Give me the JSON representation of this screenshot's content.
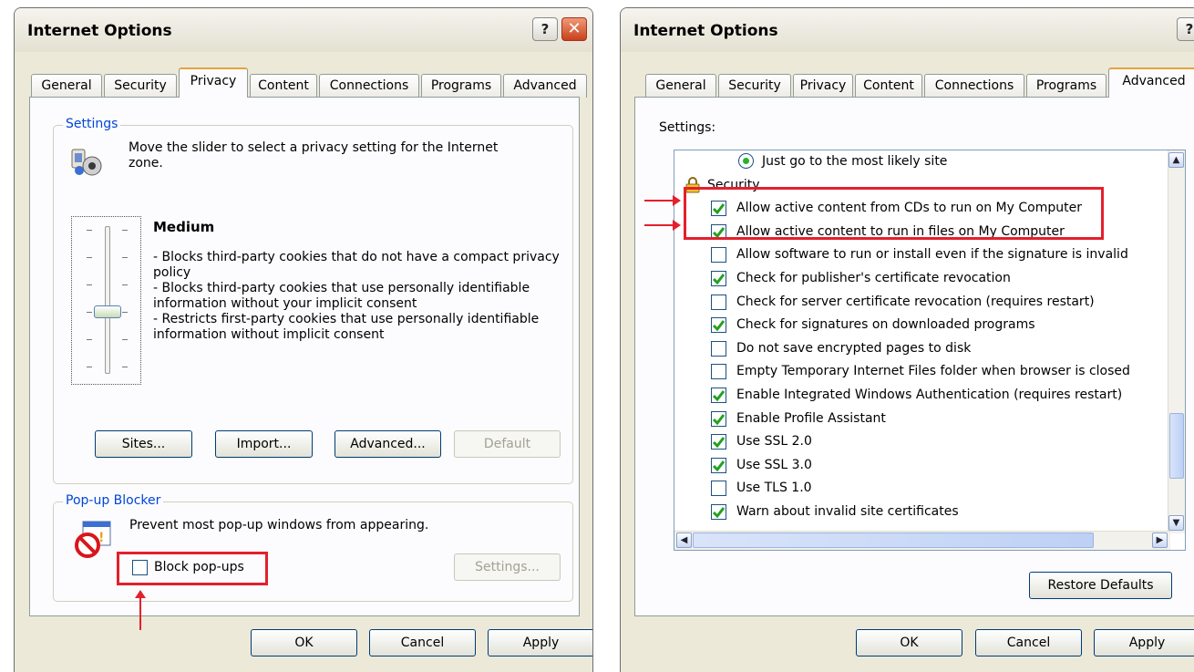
{
  "dialogs": [
    {
      "title": "Internet Options",
      "help_button": "?",
      "close_button": "✕",
      "tabs": [
        "General",
        "Security",
        "Privacy",
        "Content",
        "Connections",
        "Programs",
        "Advanced"
      ],
      "active_tab": "Privacy",
      "settings_group": {
        "legend": "Settings",
        "description": "Move the slider to select a privacy setting for the Internet zone.",
        "level_name": "Medium",
        "level_description": "- Blocks third-party cookies that do not have a compact privacy policy\n- Blocks third-party cookies that use personally identifiable information without your implicit consent\n- Restricts first-party cookies that use personally identifiable information without implicit consent",
        "slider_level": 3,
        "slider_positions": 6,
        "buttons": {
          "sites": "Sites...",
          "import": "Import...",
          "advanced": "Advanced...",
          "default": "Default"
        }
      },
      "popup_group": {
        "legend": "Pop-up Blocker",
        "description": "Prevent most pop-up windows from appearing.",
        "block_popups_label": "Block pop-ups",
        "block_popups_checked": false,
        "settings_button": "Settings..."
      },
      "footer": {
        "ok": "OK",
        "cancel": "Cancel",
        "apply": "Apply"
      }
    },
    {
      "title": "Internet Options",
      "help_button": "?",
      "close_button": "✕",
      "tabs": [
        "General",
        "Security",
        "Privacy",
        "Content",
        "Connections",
        "Programs",
        "Advanced"
      ],
      "active_tab": "Advanced",
      "settings_label": "Settings:",
      "list_items": [
        {
          "type": "radio",
          "label": "Just go to the most likely site",
          "checked": true
        },
        {
          "type": "category",
          "label": "Security"
        },
        {
          "type": "checkbox",
          "label": "Allow active content from CDs to run on My Computer",
          "checked": true
        },
        {
          "type": "checkbox",
          "label": "Allow active content to run in files on My Computer",
          "checked": true
        },
        {
          "type": "checkbox",
          "label": "Allow software to run or install even if the signature is invalid",
          "checked": false
        },
        {
          "type": "checkbox",
          "label": "Check for publisher's certificate revocation",
          "checked": true
        },
        {
          "type": "checkbox",
          "label": "Check for server certificate revocation (requires restart)",
          "checked": false
        },
        {
          "type": "checkbox",
          "label": "Check for signatures on downloaded programs",
          "checked": true
        },
        {
          "type": "checkbox",
          "label": "Do not save encrypted pages to disk",
          "checked": false
        },
        {
          "type": "checkbox",
          "label": "Empty Temporary Internet Files folder when browser is closed",
          "checked": false
        },
        {
          "type": "checkbox",
          "label": "Enable Integrated Windows Authentication (requires restart)",
          "checked": true
        },
        {
          "type": "checkbox",
          "label": "Enable Profile Assistant",
          "checked": true
        },
        {
          "type": "checkbox",
          "label": "Use SSL 2.0",
          "checked": true
        },
        {
          "type": "checkbox",
          "label": "Use SSL 3.0",
          "checked": true
        },
        {
          "type": "checkbox",
          "label": "Use TLS 1.0",
          "checked": false
        },
        {
          "type": "checkbox",
          "label": "Warn about invalid site certificates",
          "checked": true
        }
      ],
      "restore_defaults": "Restore Defaults",
      "footer": {
        "ok": "OK",
        "cancel": "Cancel",
        "apply": "Apply"
      }
    }
  ],
  "colors": {
    "highlight_red": "#e3202c",
    "check_green": "#21a121",
    "legend_blue": "#0046d5"
  },
  "icons": [
    "privacy-icon",
    "popup-blocker-icon",
    "lock-icon",
    "help-icon",
    "close-icon"
  ]
}
